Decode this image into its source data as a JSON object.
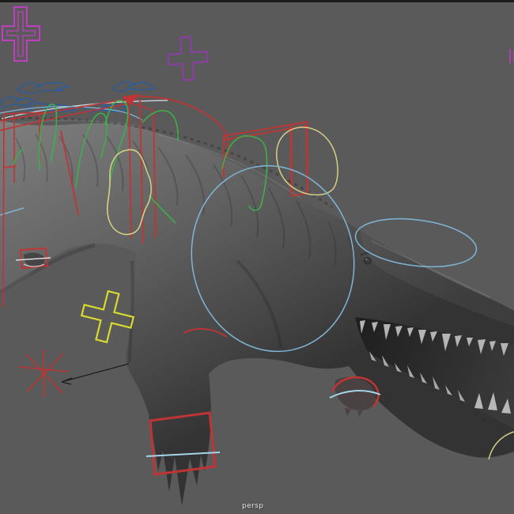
{
  "viewport": {
    "type": "maya-perspective-viewport",
    "camera_label": "persp",
    "background_color": "#5a5a5a",
    "border_top_color": "#1c1c1c",
    "model": {
      "name": "crocodile",
      "description": "gray smooth-shaded crocodile with open toothed jaw, clawed front foot, surrounded by animation rig control curves",
      "body_color_light": "#7d7d7d",
      "body_color_dark": "#333333",
      "teeth_color": "#b4b4b4",
      "mouth_interior_color": "#262626"
    },
    "rig_controls": {
      "red": "#c03434",
      "green": "#3cb049",
      "yellowpale": "#d4cf86",
      "yellow": "#d9d92e",
      "cyan": "#7fb5d6",
      "cyanlight": "#a5d5ea",
      "blue": "#2d5c9c",
      "magenta": "#c03fc0",
      "purple": "#8e3da6",
      "white": "#d9dce0",
      "arrow": "#1d1d1d"
    }
  }
}
